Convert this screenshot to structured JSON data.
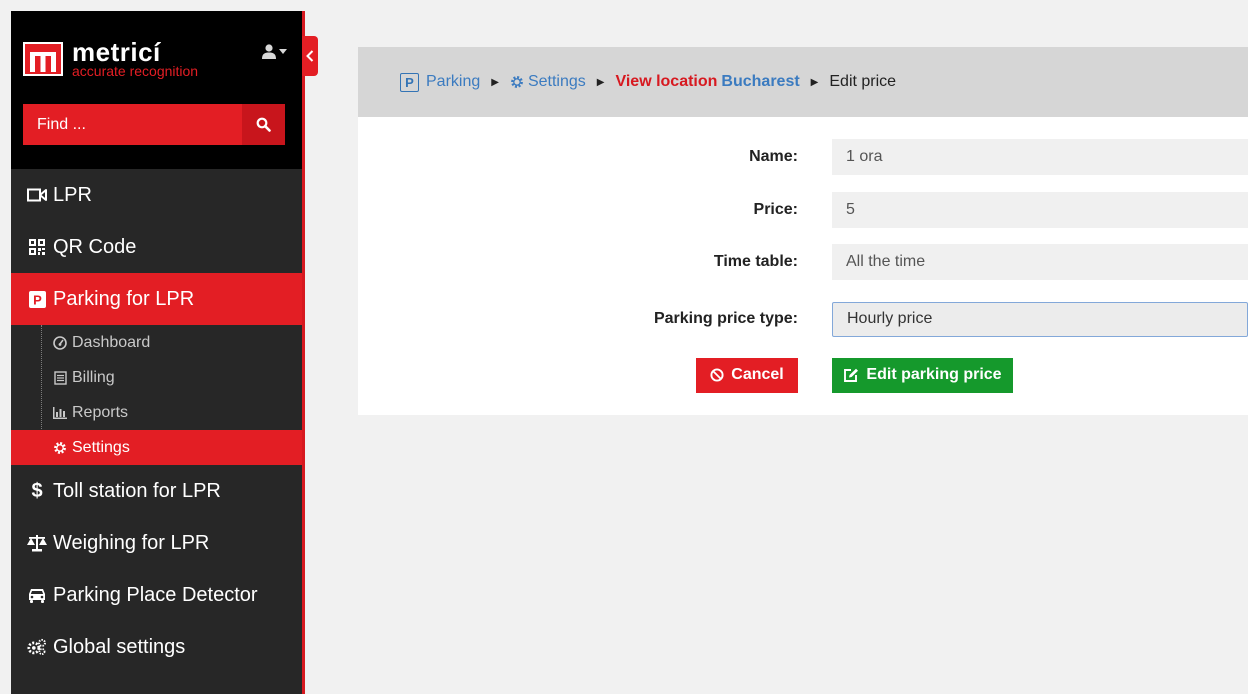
{
  "brand": {
    "name": "metricí",
    "tagline": "accurate recognition",
    "logo_letter": "m",
    "accent": "#e31e24"
  },
  "search": {
    "placeholder": "Find ..."
  },
  "sidebar": {
    "items": [
      {
        "label": "LPR",
        "icon": "video-camera-icon"
      },
      {
        "label": "QR Code",
        "icon": "qr-code-icon"
      },
      {
        "label": "Parking for LPR",
        "icon": "parking-icon",
        "active": true
      },
      {
        "label": "Toll station for LPR",
        "icon": "dollar-icon"
      },
      {
        "label": "Weighing for LPR",
        "icon": "scale-icon"
      },
      {
        "label": "Parking Place Detector",
        "icon": "car-icon"
      },
      {
        "label": "Global settings",
        "icon": "gears-icon"
      }
    ],
    "subitems": [
      {
        "label": "Dashboard",
        "icon": "dashboard-icon"
      },
      {
        "label": "Billing",
        "icon": "billing-icon"
      },
      {
        "label": "Reports",
        "icon": "bar-chart-icon"
      },
      {
        "label": "Settings",
        "icon": "cog-icon",
        "active": true
      }
    ]
  },
  "breadcrumb": {
    "icon_letter": "P",
    "parking": "Parking",
    "settings": "Settings",
    "view_location": "View location",
    "location_name": "Bucharest",
    "current": "Edit price"
  },
  "form": {
    "name_label": "Name:",
    "name_value": "1 ora",
    "price_label": "Price:",
    "price_value": "5",
    "timetable_label": "Time table:",
    "timetable_value": "All the time",
    "price_type_label": "Parking price type:",
    "price_type_value": "Hourly price",
    "cancel_label": "Cancel",
    "submit_label": "Edit parking price"
  }
}
